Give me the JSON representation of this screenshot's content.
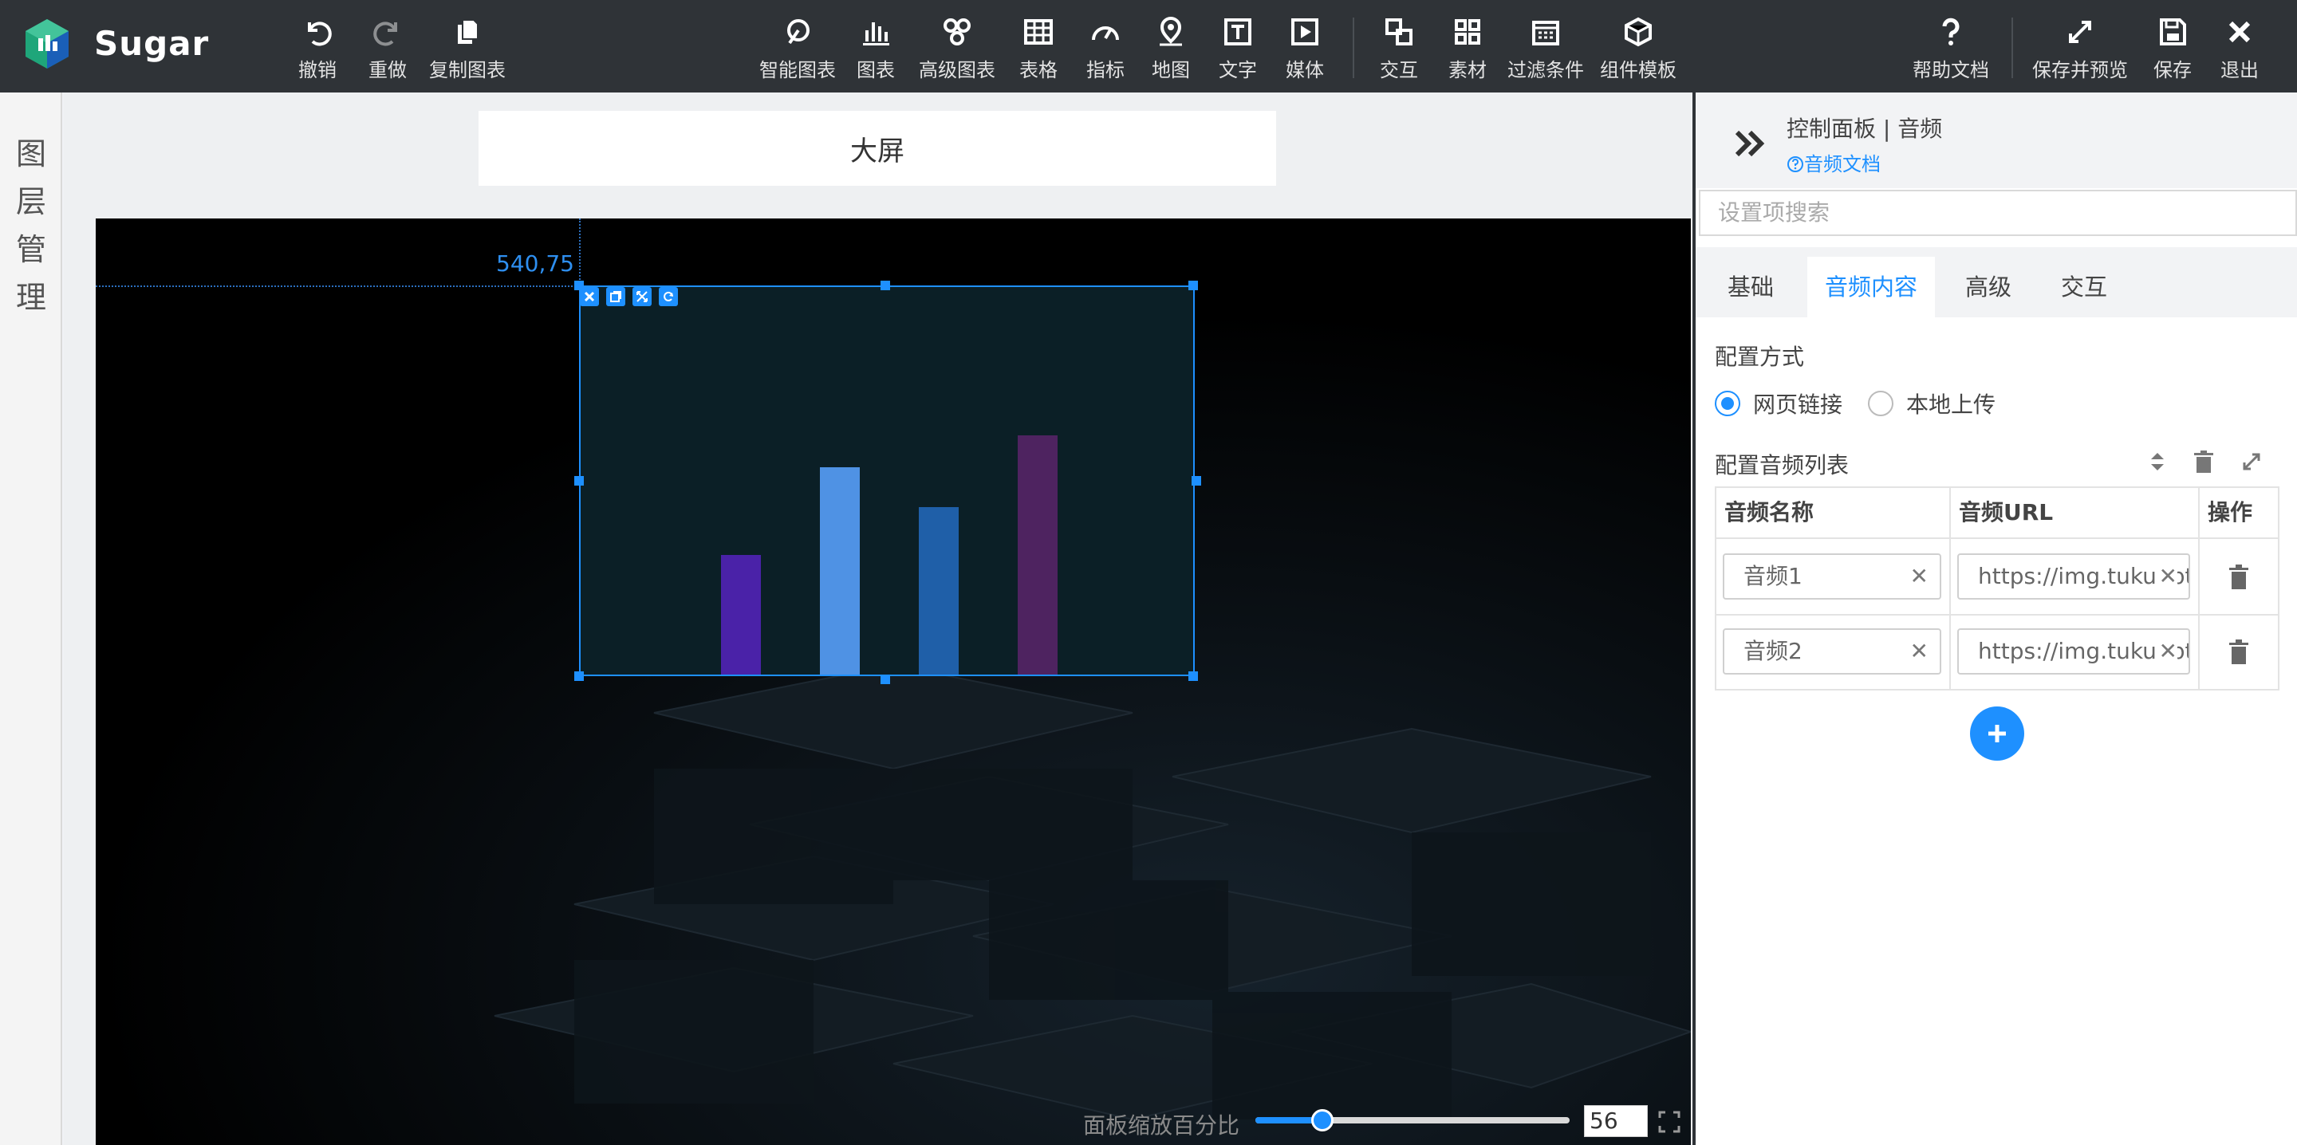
{
  "app": {
    "brand": "Sugar"
  },
  "toolbar": {
    "undo": "撤销",
    "redo": "重做",
    "copy_chart": "复制图表",
    "smart_chart": "智能图表",
    "chart": "图表",
    "advanced_chart": "高级图表",
    "table": "表格",
    "indicator": "指标",
    "map": "地图",
    "text": "文字",
    "media": "媒体",
    "interaction": "交互",
    "material": "素材",
    "filter": "过滤条件",
    "component_template": "组件模板",
    "help_doc": "帮助文档",
    "save_preview": "保存并预览",
    "save": "保存",
    "exit": "退出"
  },
  "layers": {
    "title_chars": [
      "图",
      "层",
      "管",
      "理"
    ]
  },
  "canvas": {
    "screen_title": "大屏",
    "coord_label": "540,75",
    "bars": [
      {
        "value": 30,
        "color": "#4a22a8"
      },
      {
        "value": 52,
        "color": "#4f92e4"
      },
      {
        "value": 42,
        "color": "#1f5fa8"
      },
      {
        "value": 60,
        "color": "#4e2360"
      }
    ],
    "bar_max": 60
  },
  "zoom": {
    "label": "面板缩放百分比",
    "value": "56",
    "percent": 0.56
  },
  "panel": {
    "title": "控制面板 | 音频",
    "doc_link": "音频文档",
    "search_placeholder": "设置项搜索",
    "tabs": [
      "基础",
      "音频内容",
      "高级",
      "交互"
    ],
    "active_tab": 1,
    "config_mode_label": "配置方式",
    "radio_web": "网页链接",
    "radio_local": "本地上传",
    "list_label": "配置音频列表",
    "columns": {
      "name": "音频名称",
      "url": "音频URL",
      "action": "操作"
    },
    "rows": [
      {
        "name": "音频1",
        "url": "https://img.tukuppt.com"
      },
      {
        "name": "音频2",
        "url": "https://img.tukuppt.com"
      }
    ]
  },
  "colors": {
    "accent": "#1e90ff",
    "topbar": "#2f3337"
  }
}
